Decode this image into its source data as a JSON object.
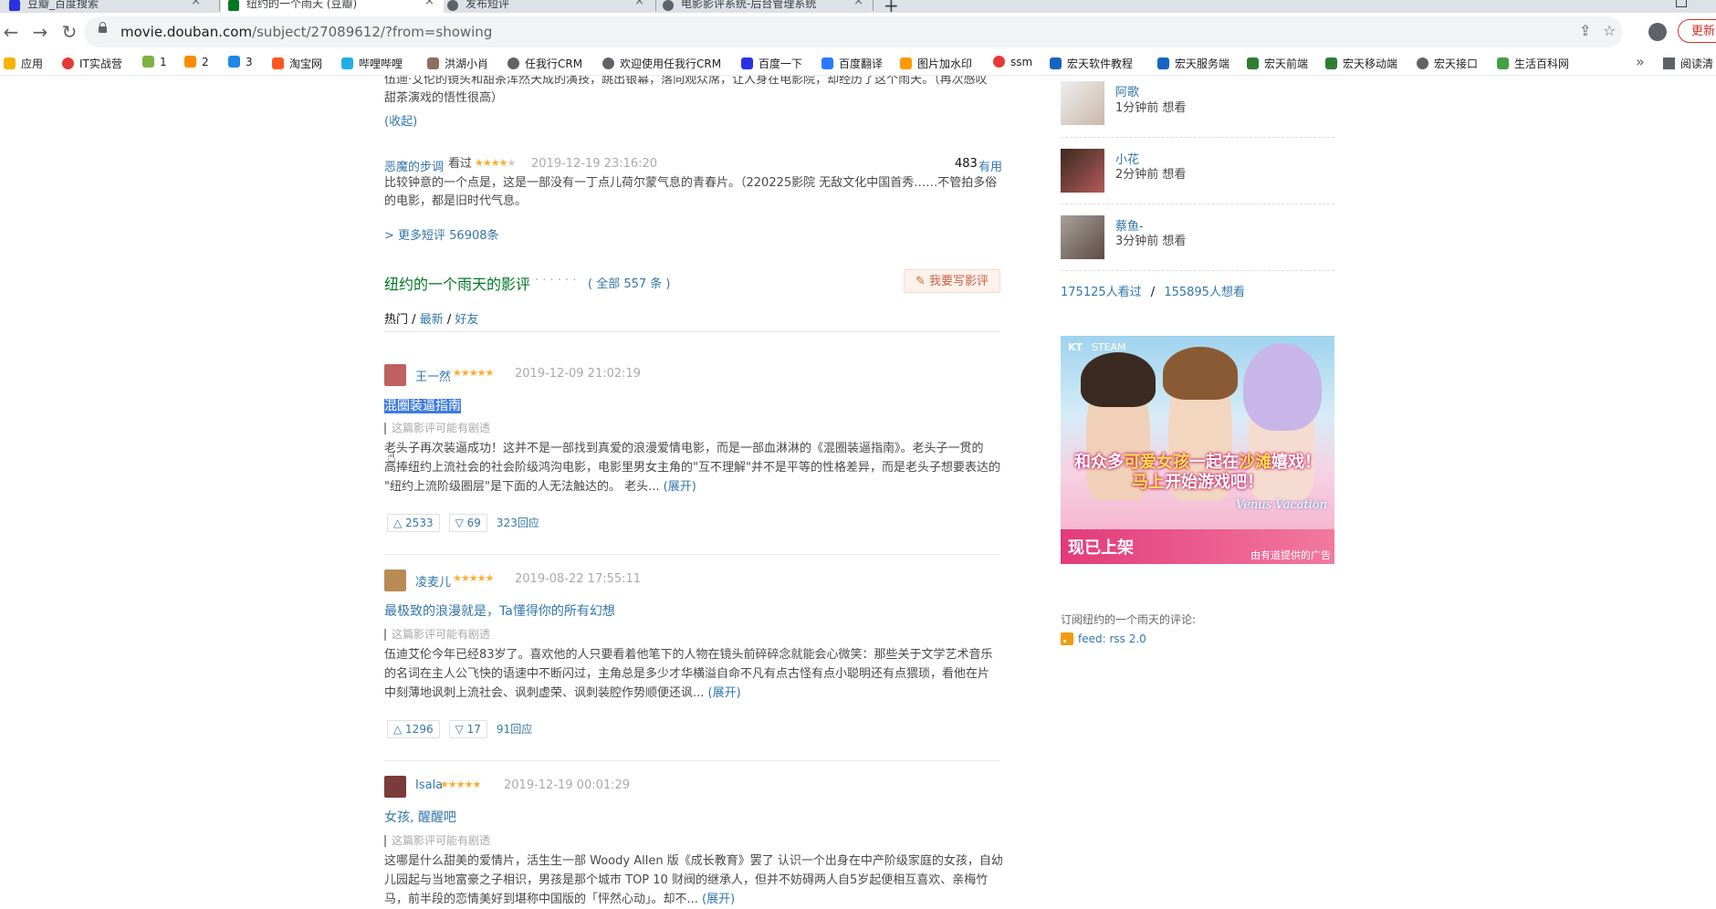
{
  "browser": {
    "tabs": [
      {
        "title": "豆瓣_百度搜索",
        "active": false
      },
      {
        "title": "纽约的一个雨天 (豆瓣)",
        "active": true
      },
      {
        "title": "发布短评",
        "active": false
      },
      {
        "title": "电影影评系统-后台管理系统",
        "active": false
      }
    ],
    "new_tab": "+",
    "url_domain": "movie.douban.com",
    "url_path": "/subject/27089612/?from=showing",
    "update_label": "更新",
    "bookmarks": [
      "应用",
      "IT实战营",
      "1",
      "2",
      "3",
      "淘宝网",
      "哔哩哔哩",
      "洪湖小肖",
      "任我行CRM",
      "欢迎使用任我行CRM",
      "百度一下",
      "百度翻译",
      "图片加水印",
      "ssm",
      "宏天软件教程",
      "宏天服务端",
      "宏天前端",
      "宏天移动端",
      "宏天接口",
      "生活百科网"
    ],
    "bookmarks_more": "»",
    "reading_list": "阅读清"
  },
  "page": {
    "top_review": {
      "snippet": "伍迪·艾伦的镜头和甜茶浑然天成的演技，跳出银幕，落向观众席，让人身在电影院，却经历了这个雨天。（再次感叹甜茶演戏的悟性很高）",
      "snippet_line1": "伍迪·艾伦的镜头和甜茶浑然天成的演技，跳出银幕，落向观众席，让人身在电影院，却经历了这个雨天。（再次感叹",
      "snippet_line2": "甜茶演戏的悟性很高）",
      "collapse": "(收起)"
    },
    "short_comment": {
      "user": "恶魔的步调",
      "status": "看过",
      "rating": 4,
      "time": "2019-12-19 23:16:20",
      "useful_count": "483",
      "useful_label": "有用",
      "line1": "比较钟意的一个点是，这是一部没有一丁点儿荷尔蒙气息的青春片。（220225影院 无敌文化中国首秀……不管拍多俗",
      "line2": "的电影，都是旧时代气息。"
    },
    "more_short_comments": "> 更多短评 56908条",
    "reviews_section": {
      "title": "纽约的一个雨天的影评",
      "dots": "· · · · · ·",
      "total": "( 全部 557 条 )",
      "write_button": "我要写影评",
      "sort": [
        "热门",
        "最新",
        "好友"
      ]
    },
    "reviews": [
      {
        "user": "王一然",
        "rating": 5,
        "time": "2019-12-09 21:02:19",
        "title": "混圈装逼指南",
        "spoiler": "这篇影评可能有剧透",
        "line1": "老头子再次装逼成功！这并不是一部找到真爱的浪漫爱情电影，而是一部血淋淋的《混圈装逼指南》。老头子一贯的",
        "line2": "高捧纽约上流社会的社会阶级鸿沟电影，电影里男女主角的\"互不理解\"并不是平等的性格差异，而是老头子想要表达的",
        "line3": "\"纽约上流阶级圈层\"是下面的人无法触达的。 老头...",
        "expand": "(展开)",
        "up": "2533",
        "down": "69",
        "replies": "323回应"
      },
      {
        "user": "凌麦儿",
        "rating": 5,
        "time": "2019-08-22 17:55:11",
        "title": "最极致的浪漫就是，Ta懂得你的所有幻想",
        "spoiler": "这篇影评可能有剧透",
        "line1": "伍迪艾伦今年已经83岁了。喜欢他的人只要看着他笔下的人物在镜头前碎碎念就能会心微笑：那些关于文学艺术音乐",
        "line2": "的名词在主人公飞快的语速中不断闪过，主角总是多少才华横溢自命不凡有点古怪有点小聪明还有点猥琐，看他在片",
        "line3": "中刻薄地讽刺上流社会、讽刺虚荣、讽刺装腔作势顺便还讽...",
        "expand": "(展开)",
        "up": "1296",
        "down": "17",
        "replies": "91回应"
      },
      {
        "user": "Isala",
        "rating": 5,
        "time": "2019-12-19 00:01:29",
        "title": "女孩, 醒醒吧",
        "spoiler": "这篇影评可能有剧透",
        "line1": "这哪是什么甜美的爱情片，活生生一部 Woody Allen 版《成长教育》罢了 认识一个出身在中产阶级家庭的女孩，自幼",
        "line2": "儿园起与当地富豪之子相识，男孩是那个城市 TOP 10 财阀的继承人，但并不妨碍两人自5岁起便相互喜欢、亲梅竹",
        "line3": "马，前半段的恋情美好到堪称中国版的「怦然心动」。却不...",
        "expand": "(展开)"
      }
    ],
    "sidebar": {
      "wishers": [
        {
          "name": "阿歌",
          "activity": "1分钟前 想看"
        },
        {
          "name": "小花",
          "activity": "2分钟前 想看"
        },
        {
          "name": "蔡鱼-",
          "activity": "3分钟前 想看"
        }
      ],
      "watched": "175125人看过",
      "separator": "/",
      "wanted": "155895人想看",
      "ad": {
        "logo": "KT",
        "platform": "STEAM",
        "slogan_pre": "和众多",
        "slogan_em1": "可爱女孩",
        "slogan_mid": "一起在",
        "slogan_em2": "沙滩",
        "slogan_post": "嬉戏！",
        "slogan2_em": "马上",
        "slogan2_post": "开始游戏吧！",
        "release": "现已上架",
        "brand": "Venus Vacation",
        "note": "由有道提供的广告"
      },
      "subscribe": "订阅纽约的一个雨天的评论:",
      "feed": "feed: rss 2.0"
    }
  }
}
